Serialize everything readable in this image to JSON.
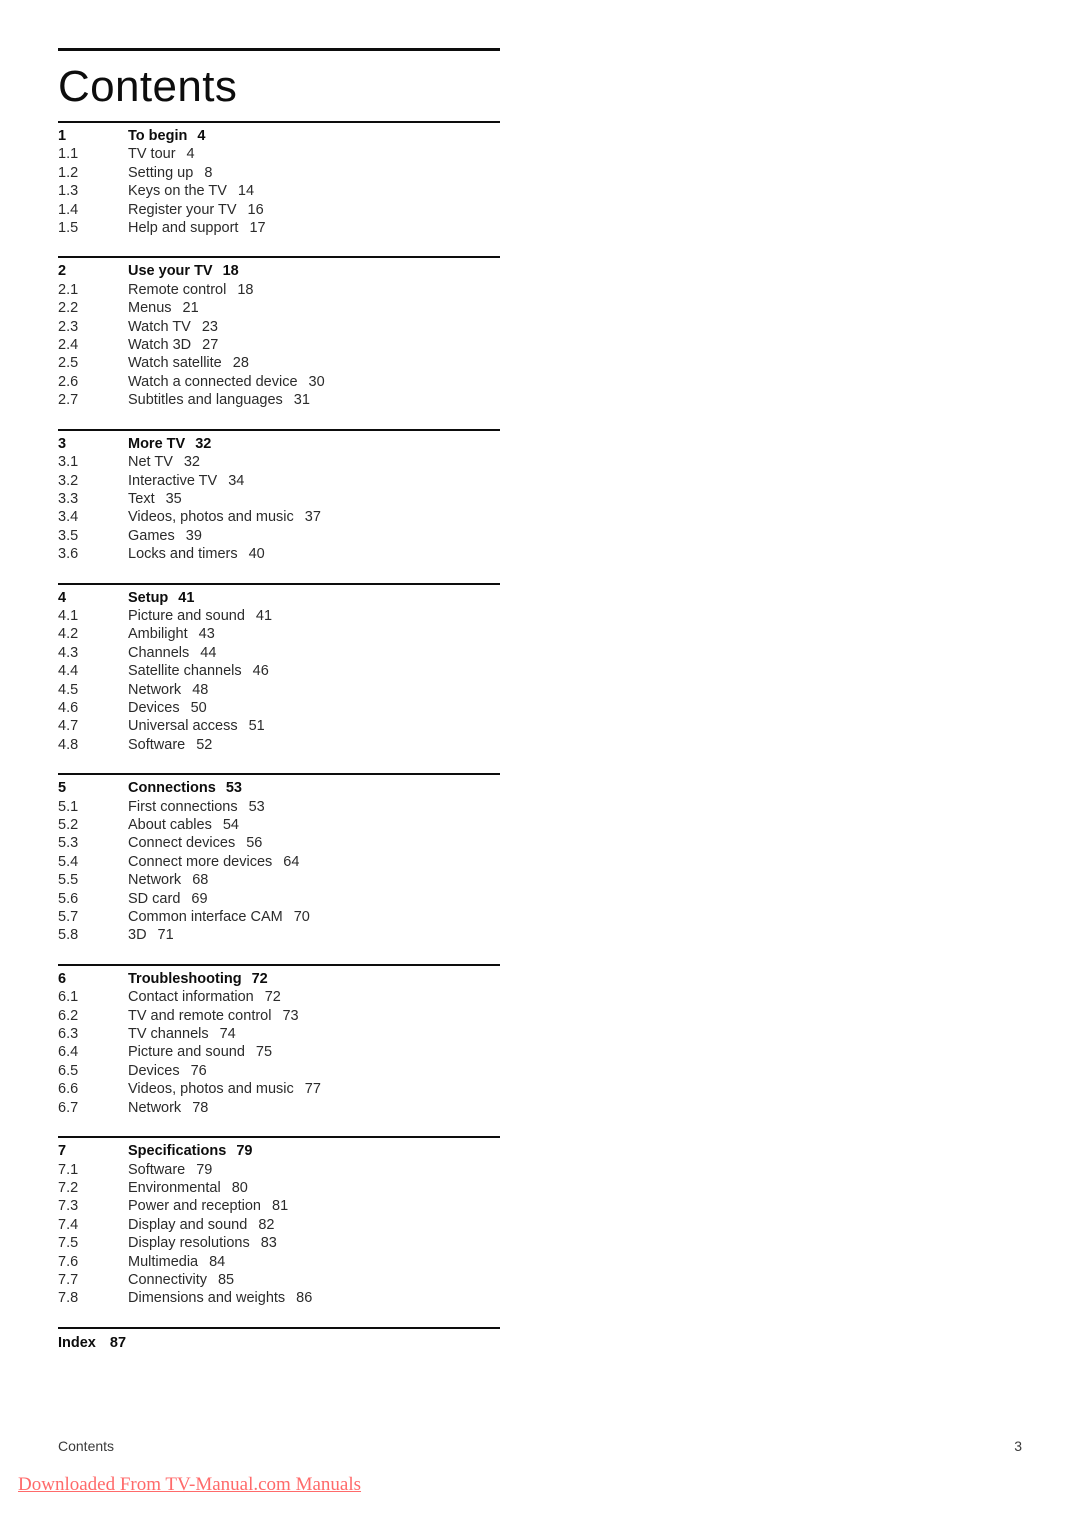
{
  "document": {
    "title": "Contents",
    "footer_label": "Contents",
    "page_number": "3",
    "watermark": "Downloaded From TV-Manual.com Manuals",
    "accent_color": "#ff6a6a",
    "text_color": "#2b2b2b",
    "rule_color": "#0d0d0d"
  },
  "sections": [
    {
      "header": {
        "num": "1",
        "title": "To begin",
        "page": "4"
      },
      "entries": [
        {
          "num": "1.1",
          "title": "TV tour",
          "page": "4"
        },
        {
          "num": "1.2",
          "title": "Setting up",
          "page": "8"
        },
        {
          "num": "1.3",
          "title": "Keys on the TV",
          "page": "14"
        },
        {
          "num": "1.4",
          "title": "Register your TV",
          "page": "16"
        },
        {
          "num": "1.5",
          "title": "Help and support",
          "page": "17"
        }
      ]
    },
    {
      "header": {
        "num": "2",
        "title": "Use your TV",
        "page": "18"
      },
      "entries": [
        {
          "num": "2.1",
          "title": "Remote control",
          "page": "18"
        },
        {
          "num": "2.2",
          "title": "Menus",
          "page": "21"
        },
        {
          "num": "2.3",
          "title": "Watch TV",
          "page": "23"
        },
        {
          "num": "2.4",
          "title": "Watch 3D",
          "page": "27"
        },
        {
          "num": "2.5",
          "title": "Watch satellite",
          "page": "28"
        },
        {
          "num": "2.6",
          "title": "Watch a connected device",
          "page": "30"
        },
        {
          "num": "2.7",
          "title": "Subtitles and languages",
          "page": "31"
        }
      ]
    },
    {
      "header": {
        "num": "3",
        "title": "More TV",
        "page": "32"
      },
      "entries": [
        {
          "num": "3.1",
          "title": "Net TV",
          "page": "32"
        },
        {
          "num": "3.2",
          "title": "Interactive TV",
          "page": "34"
        },
        {
          "num": "3.3",
          "title": "Text",
          "page": "35"
        },
        {
          "num": "3.4",
          "title": "Videos, photos and music",
          "page": "37"
        },
        {
          "num": "3.5",
          "title": "Games",
          "page": "39"
        },
        {
          "num": "3.6",
          "title": "Locks and timers",
          "page": "40"
        }
      ]
    },
    {
      "header": {
        "num": "4",
        "title": "Setup",
        "page": "41"
      },
      "entries": [
        {
          "num": "4.1",
          "title": "Picture and sound",
          "page": "41"
        },
        {
          "num": "4.2",
          "title": "Ambilight",
          "page": "43"
        },
        {
          "num": "4.3",
          "title": "Channels",
          "page": "44"
        },
        {
          "num": "4.4",
          "title": "Satellite channels",
          "page": "46"
        },
        {
          "num": "4.5",
          "title": "Network",
          "page": "48"
        },
        {
          "num": "4.6",
          "title": "Devices",
          "page": "50"
        },
        {
          "num": "4.7",
          "title": "Universal access",
          "page": "51"
        },
        {
          "num": "4.8",
          "title": "Software",
          "page": "52"
        }
      ]
    },
    {
      "header": {
        "num": "5",
        "title": "Connections",
        "page": "53"
      },
      "entries": [
        {
          "num": "5.1",
          "title": "First connections",
          "page": "53"
        },
        {
          "num": "5.2",
          "title": "About cables",
          "page": "54"
        },
        {
          "num": "5.3",
          "title": "Connect devices",
          "page": "56"
        },
        {
          "num": "5.4",
          "title": "Connect more devices",
          "page": "64"
        },
        {
          "num": "5.5",
          "title": "Network",
          "page": "68"
        },
        {
          "num": "5.6",
          "title": "SD card",
          "page": "69"
        },
        {
          "num": "5.7",
          "title": "Common interface CAM",
          "page": "70"
        },
        {
          "num": "5.8",
          "title": "3D",
          "page": "71"
        }
      ]
    },
    {
      "header": {
        "num": "6",
        "title": "Troubleshooting",
        "page": "72"
      },
      "entries": [
        {
          "num": "6.1",
          "title": "Contact information",
          "page": "72"
        },
        {
          "num": "6.2",
          "title": "TV and remote control",
          "page": "73"
        },
        {
          "num": "6.3",
          "title": "TV channels",
          "page": "74"
        },
        {
          "num": "6.4",
          "title": "Picture and sound",
          "page": "75"
        },
        {
          "num": "6.5",
          "title": "Devices",
          "page": "76"
        },
        {
          "num": "6.6",
          "title": "Videos, photos and music",
          "page": "77"
        },
        {
          "num": "6.7",
          "title": "Network",
          "page": "78"
        }
      ]
    },
    {
      "header": {
        "num": "7",
        "title": "Specifications",
        "page": "79"
      },
      "entries": [
        {
          "num": "7.1",
          "title": "Software",
          "page": "79"
        },
        {
          "num": "7.2",
          "title": "Environmental",
          "page": "80"
        },
        {
          "num": "7.3",
          "title": "Power and reception",
          "page": "81"
        },
        {
          "num": "7.4",
          "title": "Display and sound",
          "page": "82"
        },
        {
          "num": "7.5",
          "title": "Display resolutions",
          "page": "83"
        },
        {
          "num": "7.6",
          "title": "Multimedia",
          "page": "84"
        },
        {
          "num": "7.7",
          "title": "Connectivity",
          "page": "85"
        },
        {
          "num": "7.8",
          "title": "Dimensions and weights",
          "page": "86"
        }
      ]
    }
  ],
  "index": {
    "title": "Index",
    "page": "87"
  }
}
